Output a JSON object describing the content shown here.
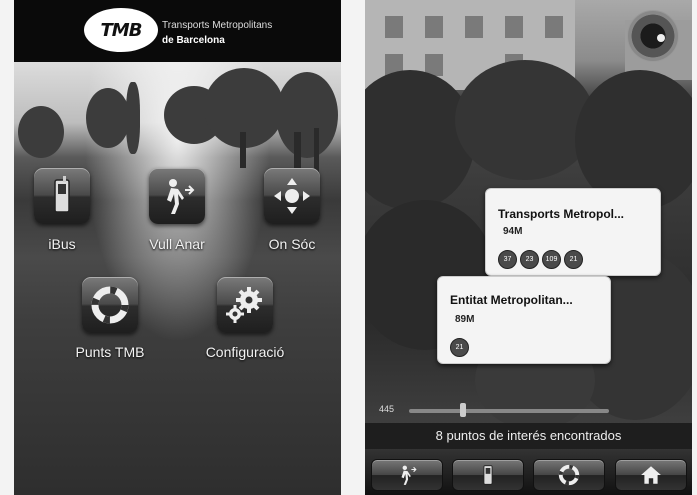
{
  "left_screen": {
    "header": {
      "logo_text": "TMB",
      "line1": "Transports Metropolitans",
      "line2": "de Barcelona"
    },
    "menu": [
      {
        "label": "iBus",
        "icon": "phone-icon"
      },
      {
        "label": "Vull Anar",
        "icon": "walking-person-icon"
      },
      {
        "label": "On Sóc",
        "icon": "direction-pad-icon"
      },
      {
        "label": "Punts TMB",
        "icon": "lifebuoy-icon"
      },
      {
        "label": "Configuració",
        "icon": "gears-icon"
      }
    ]
  },
  "right_screen": {
    "pois": [
      {
        "title": "Transports Metropol...",
        "distance": "94M",
        "badges": [
          "37",
          "23",
          "109",
          "21"
        ]
      },
      {
        "title": "Entitat Metropolitan...",
        "distance": "89M",
        "badges": [
          "21"
        ]
      }
    ],
    "range_value": "445",
    "range_fraction": 0.27,
    "status": "8 puntos de interés encontrados",
    "toolbar": [
      {
        "icon": "walking-person-icon"
      },
      {
        "icon": "phone-icon"
      },
      {
        "icon": "lifebuoy-icon"
      },
      {
        "icon": "home-icon"
      }
    ]
  },
  "colors": {
    "header_bg": "#0a0a0a",
    "card_bg": "#f4f4f4",
    "badge_bg": "#4a4a4a"
  }
}
